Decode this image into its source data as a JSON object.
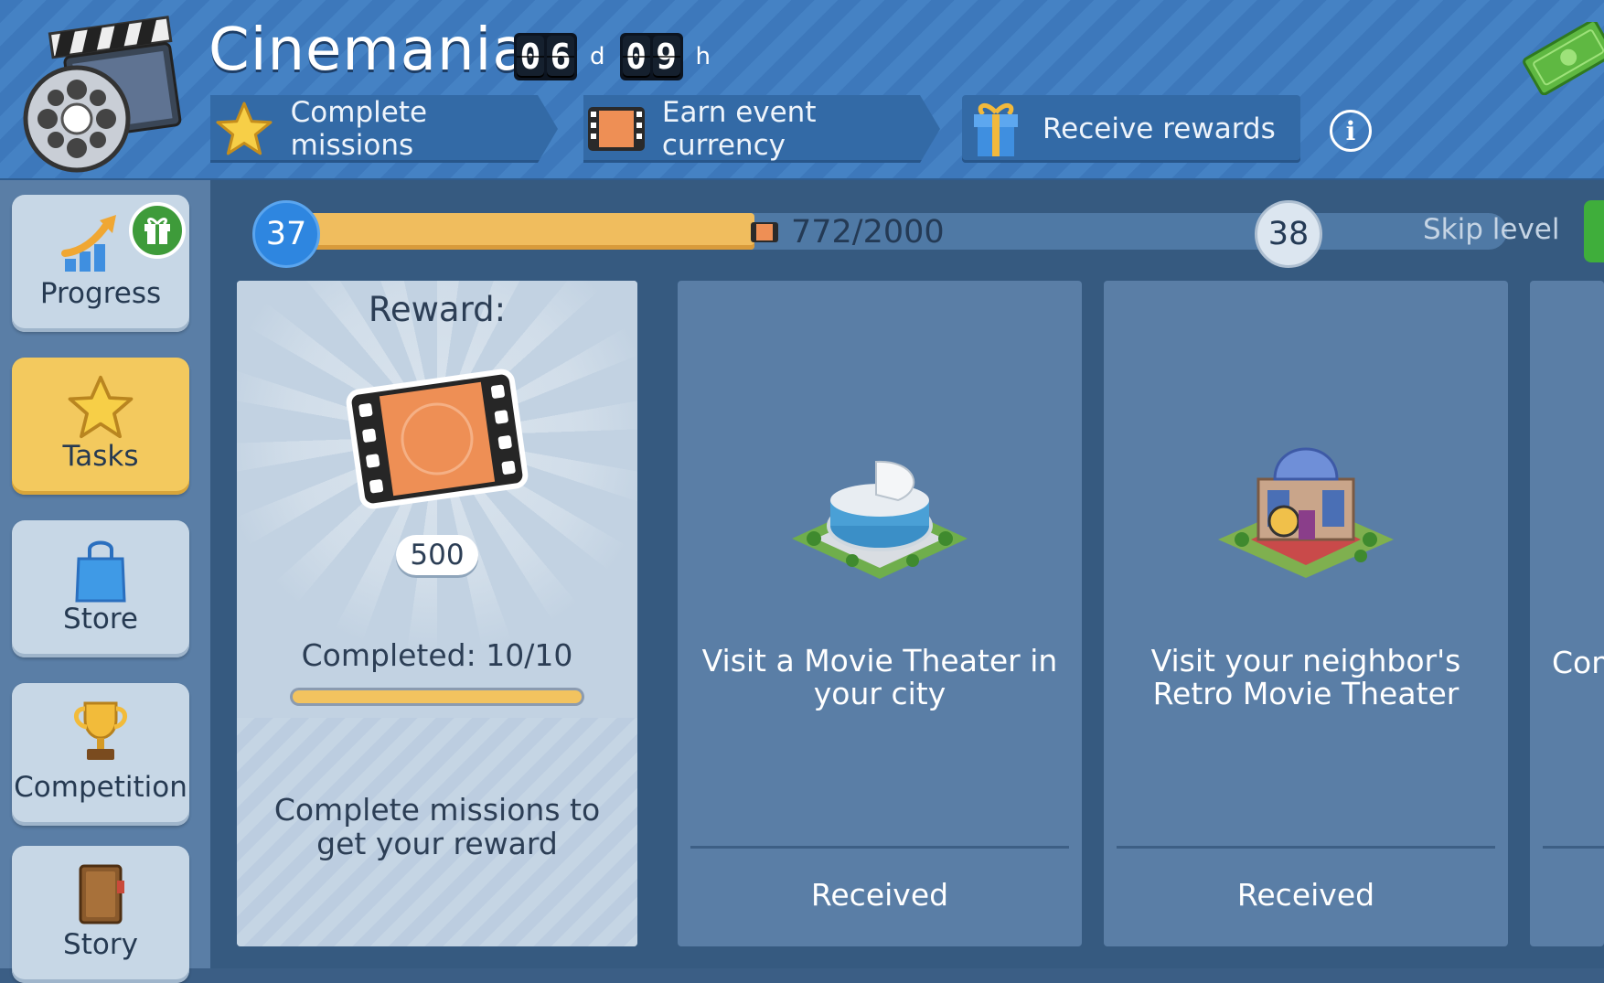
{
  "header": {
    "title": "Cinemania",
    "timer": {
      "days": [
        "0",
        "6"
      ],
      "day_unit": "d",
      "hours": [
        "0",
        "9"
      ],
      "hour_unit": "h"
    },
    "steps": [
      {
        "label": "Complete missions",
        "icon": "star-icon"
      },
      {
        "label": "Earn event currency",
        "icon": "film-ticket-icon"
      },
      {
        "label": "Receive rewards",
        "icon": "gift-icon"
      }
    ],
    "info_label": "i"
  },
  "sidebar": {
    "items": [
      {
        "label": "Progress",
        "icon": "progress-arrow-icon",
        "active": false,
        "badge": "gift-badge-icon"
      },
      {
        "label": "Tasks",
        "icon": "star-icon",
        "active": true
      },
      {
        "label": "Store",
        "icon": "shopping-bag-icon",
        "active": false
      },
      {
        "label": "Competition",
        "icon": "trophy-icon",
        "active": false
      },
      {
        "label": "Story",
        "icon": "book-icon",
        "active": false
      }
    ]
  },
  "progress": {
    "current_level": "37",
    "next_level": "38",
    "value_text": "772/2000",
    "fraction": 0.386,
    "skip_label": "Skip level"
  },
  "reward_card": {
    "title": "Reward:",
    "amount": "500",
    "completed_text": "Completed: 10/10",
    "completed_fraction": 1.0,
    "note": "Complete missions to get your reward"
  },
  "missions": [
    {
      "text": "Visit a Movie Theater in your city",
      "status": "Received",
      "image": "movie-theater-building-icon"
    },
    {
      "text": "Visit your neighbor's Retro Movie Theater",
      "status": "Received",
      "image": "retro-movie-theater-building-icon"
    }
  ],
  "peek_mission": {
    "text": "Com"
  },
  "colors": {
    "header_blue": "#3d78bb",
    "accent_yellow": "#f0bd5e",
    "level_blue": "#2e86e0",
    "card_blue": "#5a7ea6",
    "reward_card": "#c2d2e2",
    "skip_green": "#3fae3b"
  }
}
